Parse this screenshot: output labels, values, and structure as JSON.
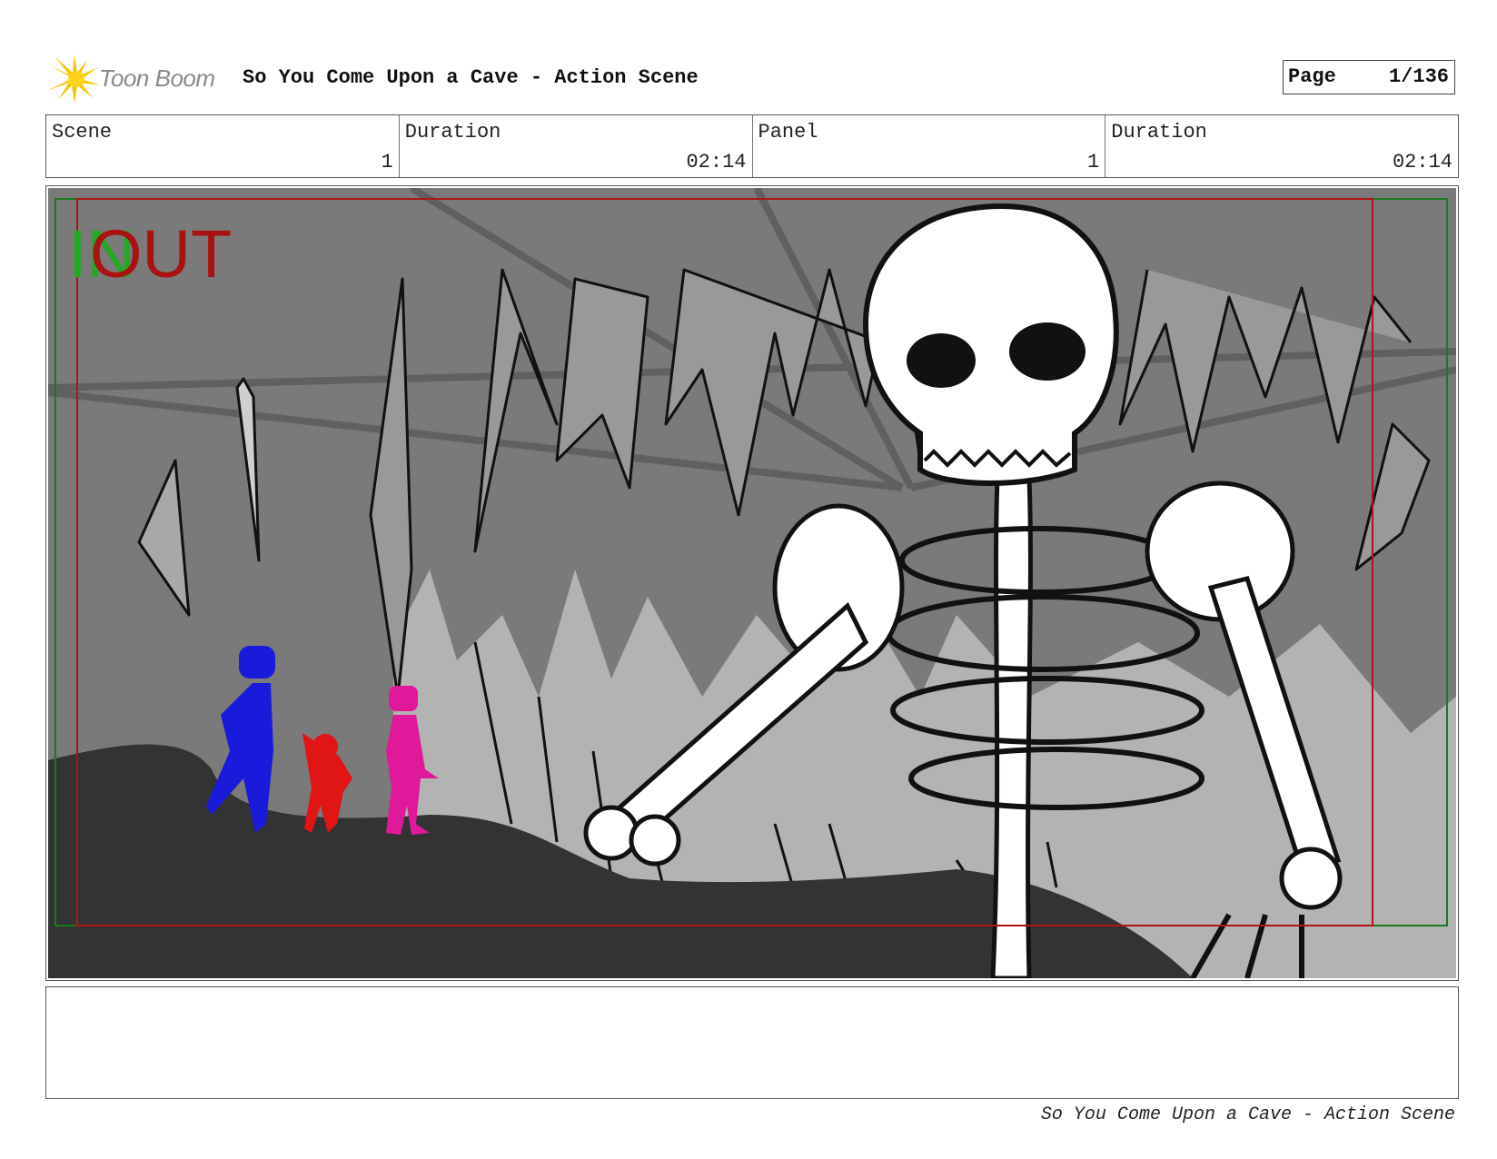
{
  "header": {
    "logo_text": "Toon Boom",
    "title": "So You Come Upon a Cave - Action Scene",
    "page_label": "Page",
    "page_value": "1/136"
  },
  "info": {
    "scene_label": "Scene",
    "scene_value": "1",
    "scene_duration_label": "Duration",
    "scene_duration_value": "02:14",
    "panel_label": "Panel",
    "panel_value": "1",
    "panel_duration_label": "Duration",
    "panel_duration_value": "02:14"
  },
  "panel": {
    "overlay_in": "IN",
    "overlay_out": "OUT",
    "colors": {
      "in_marker": "#22aa22",
      "out_marker": "#aa1111",
      "character_blue": "#1a1adb",
      "character_red": "#e01515",
      "character_pink": "#e0189a"
    }
  },
  "notes": {
    "text": ""
  },
  "footer": {
    "text": "So You Come Upon a Cave - Action Scene"
  }
}
